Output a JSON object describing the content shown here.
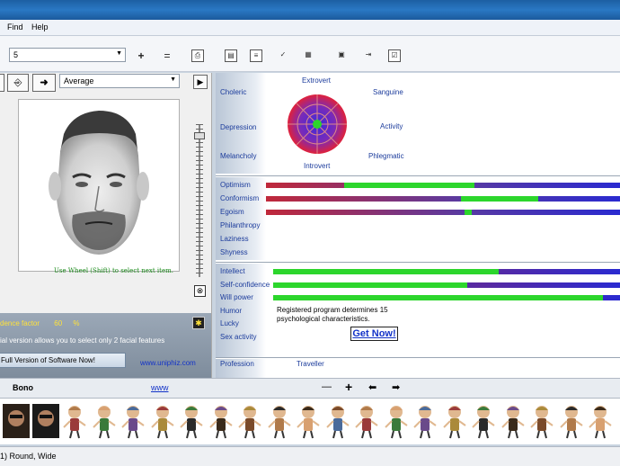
{
  "menu": {
    "find": "Find",
    "help": "Help"
  },
  "toolbar": {
    "combo_value": "5",
    "average_value": "Average",
    "plus_label": "+",
    "minus_label": "=",
    "forward_label": "▶"
  },
  "left": {
    "hint": "Use Wheel (Shift) to select next item.",
    "license_label": "dence factor",
    "license_value": "60",
    "license_unit": "%",
    "demo_note": "ial version allows you to select only 2 facial features",
    "full_version_button": "Full Version of Software Now!",
    "site": "www.uniphiz.com"
  },
  "temperament": {
    "extrovert": "Extrovert",
    "introvert": "Introvert",
    "choleric": "Choleric",
    "sanguine": "Sanguine",
    "depression": "Depression",
    "activity": "Activity",
    "melancholy": "Melancholy",
    "phlegmatic": "Phlegmatic"
  },
  "traits1": [
    {
      "label": "Optimism",
      "fill": 0.37,
      "start": 0.22
    },
    {
      "label": "Conformism",
      "fill": 0.22,
      "start": 0.55
    },
    {
      "label": "Egoism",
      "fill": 0.02,
      "start": 0.56
    },
    {
      "label": "Philanthropy"
    },
    {
      "label": "Laziness"
    },
    {
      "label": "Shyness"
    }
  ],
  "traits2": [
    {
      "label": "Intellect",
      "fill": 0.65
    },
    {
      "label": "Self-confidence",
      "fill": 0.56
    },
    {
      "label": "Will power",
      "fill": 0.95
    },
    {
      "label": "Humor"
    },
    {
      "label": "Lucky"
    },
    {
      "label": "Sex activity"
    }
  ],
  "registered_note": "Registered program determines 15 psychological characteristics.",
  "get_now": "Get Now!",
  "profession_label": "Profession",
  "profession_value": "Traveller",
  "bottom": {
    "name": "Bono",
    "link": "www",
    "minus": "—",
    "plus": "+",
    "left": "⬅",
    "right": "➡"
  },
  "status": "1) Round, Wide",
  "colors": {
    "accent": "#1c3c9c",
    "fill": "#2cd62c",
    "title": "#1c5fa3"
  }
}
